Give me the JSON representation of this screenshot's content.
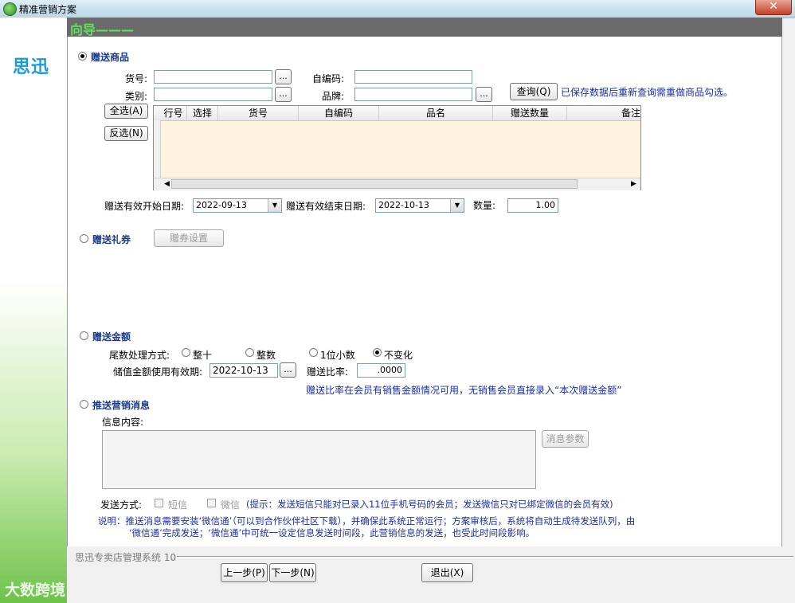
{
  "window": {
    "title": "精准营销方案",
    "close_glyph": "✕"
  },
  "sidebar": {
    "logo": "思迅",
    "watermark": "大数跨境"
  },
  "wizard": {
    "title": "向导———"
  },
  "gift_goods": {
    "label": "赠送商品",
    "goods_no_label": "货号:",
    "goods_no_value": "",
    "category_label": "类别:",
    "category_value": "",
    "selfcode_label": "自编码:",
    "selfcode_value": "",
    "brand_label": "品牌:",
    "brand_value": "",
    "ellipsis": "...",
    "query_button": "查询(Q)",
    "query_hint": "已保存数据后重新查询需重做商品勾选。",
    "select_all_button": "全选(A)",
    "invert_button": "反选(N)",
    "columns": [
      "行号",
      "选择",
      "货号",
      "自编码",
      "品名",
      "赠送数量",
      "备注"
    ],
    "start_date_label": "赠送有效开始日期:",
    "start_date": "2022-09-13",
    "end_date_label": "赠送有效结束日期:",
    "end_date": "2022-10-13",
    "qty_label": "数量:",
    "qty_value": "1.00"
  },
  "gift_coupon": {
    "label": "赠送礼券",
    "settings_button": "赠券设置"
  },
  "gift_amount": {
    "label": "赠送金额",
    "tail_label": "尾数处理方式:",
    "options": [
      "整十",
      "整数",
      "1位小数",
      "不变化"
    ],
    "selected": "不变化",
    "valid_label": "储值金额使用有效期:",
    "valid_date": "2022-10-13",
    "ratio_label": "赠送比率:",
    "ratio_value": ".0000",
    "ratio_hint": "赠送比率在会员有销售金额情况可用，无销售会员直接录入“本次赠送金额”"
  },
  "push_msg": {
    "label": "推送营销消息",
    "content_label": "信息内容:",
    "content_value": "",
    "params_button": "消息参数",
    "send_label": "发送方式:",
    "sms_label": "短信",
    "wechat_label": "微信",
    "send_hint": "(提示：发送短信只能对已录入11位手机号码的会员；发送微信只对已绑定微信的会员有效)",
    "note_line1": "说明：推送消息需要安装‘微信通’（可以到合作伙伴社区下载），并确保此系统正常运行；方案审核后，系统将自动生成待发送队列，由",
    "note_line2": "‘微信通’完成发送；‘微信通’中可统一设定信息发送时间段，此营销信息的发送，也受此时间段影响。"
  },
  "footer": {
    "system_name": "思迅专卖店管理系统 10",
    "prev_button": "上一步(P)",
    "next_button": "下一步(N)",
    "exit_button": "退出(X)"
  }
}
